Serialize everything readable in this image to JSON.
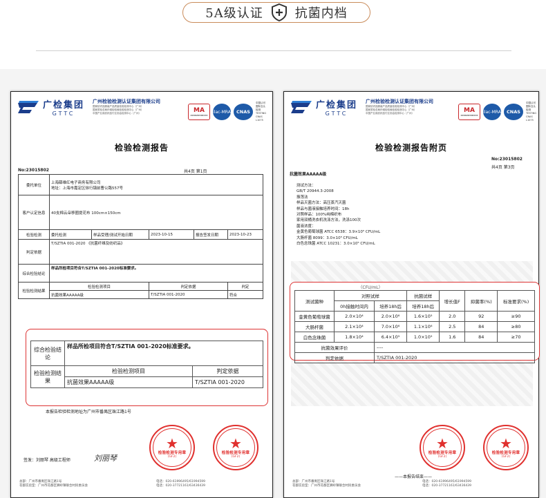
{
  "header": {
    "left_text": "5A级认证",
    "right_text": "抗菌内档",
    "icon": "shield-plus-icon"
  },
  "org": {
    "brand_cn": "广检集团",
    "brand_en": "GTTC",
    "name": "广州检验检测认证集团有限公司",
    "sub1": "国家纺织品服装产品质量检验检测中心（广州）",
    "sub2": "国家质检总局纤维检验局检验检测中心（广州）",
    "sub3": "中国产业用纺织品行业协会检测中心（广州）",
    "cma": "MA",
    "cma_no": "220020348434",
    "ilac": "ilac-MRA",
    "cnas": "CNAS",
    "testing": "中国认可 国际互认 检测 TESTING CNAS L1075"
  },
  "left_doc": {
    "title": "检验检测报告",
    "no": "No:23015802",
    "pages": "共4页 第1页",
    "rows": {
      "client_label": "委托单位",
      "client_value": "上海薛维红电子商务有限公司",
      "client_address": "地址：上海市嘉定区徐行镇前曹公路557号",
      "sample_label": "客户认定信息",
      "sample_value": "40支棉云朵移圈提花布    100cm×150cm",
      "inspect_type_label": "检验检测",
      "inspect_type_value": "委托检测",
      "date_label": "样品受理/测试开始日期",
      "date_value": "2023-10-15",
      "issue_label": "报告签发日期",
      "issue_value": "2023-10-23",
      "basis_value": "T/SZTIA 001-2020 《抗菌纤维及纺织品》",
      "basis_label": "判定依据",
      "conclusion_label": "综合检验结论",
      "conclusion_value": "样品所检项目符合T/SZTIA 001-2020标准要求。",
      "results_label": "检验检测结果",
      "item_header": "检验检测项目",
      "standard_header": "判定依据",
      "judge_header": "判定",
      "item_value": "抗菌效果AAAAA级",
      "standard_value": "T/SZTIA 001-2020",
      "judge_value": "符合"
    },
    "callout": {
      "conclusion_label": "综合检验结论",
      "conclusion_value": "样品所检项目符合T/SZTIA 001-2020标准要求。",
      "results_label": "检验检测结果",
      "item_header": "检验检测项目",
      "standard_header": "判定依据",
      "item_value": "抗菌效果AAAAA级",
      "standard_value": "T/SZTIA 001-2020"
    },
    "note": "本报告检验检测地址为广州市番禺区珠江路1号",
    "sign": "签发：刘丽琴  高级工程师",
    "signature": "刘丽琴",
    "footer1": "总部：广州市番禺区珠江路1号",
    "footer2": "花都实验室：广州市花都区狮岭镇联合村民委员会",
    "footer3": "电话：020-61996495/61994599",
    "footer4": "电话：020-37721161/63436439"
  },
  "right_doc": {
    "title": "检验检测报告附页",
    "no": "No:23015802",
    "pages": "共4页 第3页",
    "section": "抗菌效果AAAAA级",
    "method_lines": [
      "测试方法：",
      "GB/T 20944.3-2008",
      "振荡法",
      "样品灭菌方法：高压蒸汽灭菌",
      "样品与菌液接触培养时间：18h",
      "对照样品：100%纯棉织布",
      "家用双桶洗衣机洗涤方法，洗涤100次",
      "菌液浓度：",
      "金黄色葡萄球菌 ATCC 6538：3.9×10⁵ CFU/mL",
      "大肠杆菌 8099：3.0×10⁵ CFU/mL",
      "白色念珠菌 ATCC 10231：3.0×10⁵ CFU/mL"
    ],
    "table": {
      "unit_header": "（CFU/mL）",
      "species_header": "测试菌种",
      "control_header": "对照试样",
      "sample_header": "抗菌试样",
      "control_0h": "0h接触时间内",
      "control_18h": "培养18h后",
      "sample_18h": "培养18h后",
      "growth_header": "增长值F",
      "rate_header": "抑菌率(%)",
      "req_header": "标准要求(%)",
      "rows": [
        {
          "species": "金黄色葡萄球菌",
          "c0": "2.0×10⁴",
          "c18": "2.0×10⁶",
          "s18": "1.6×10⁵",
          "f": "2.0",
          "rate": "92",
          "req": "≥90"
        },
        {
          "species": "大肠杆菌",
          "c0": "2.1×10⁴",
          "c18": "7.0×10⁶",
          "s18": "1.1×10⁶",
          "f": "2.5",
          "rate": "84",
          "req": "≥80"
        },
        {
          "species": "白色念珠菌",
          "c0": "1.8×10⁴",
          "c18": "6.4×10⁵",
          "s18": "1.0×10⁵",
          "f": "1.6",
          "rate": "84",
          "req": "≥70"
        }
      ],
      "eval_label": "抗菌效果评价",
      "eval_value": "----",
      "basis_label": "判定依据",
      "basis_value": "T/SZTIA 001-2020"
    },
    "end_note": "——本报告结束——",
    "footer1": "总部：广州市番禺区珠江路1号",
    "footer2": "花都实验室：广州市花都区狮岭镇联合村民委员会",
    "footer3": "电话：020-61996495/61994599",
    "footer4": "电话：020-37721161/63436439"
  },
  "stamp": {
    "label": "检验检测专用章",
    "code": "(GF2)",
    "ring_text": "广州检验检测认证集团有限公司"
  },
  "colors": {
    "accent_orange": "#c98b5a",
    "brand_blue": "#1b3d8b",
    "stamp_red": "#e0302e",
    "callout_red": "#dd3333"
  }
}
